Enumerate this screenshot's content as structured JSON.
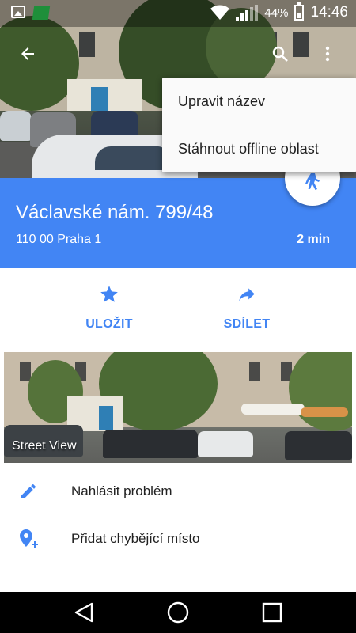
{
  "status_bar": {
    "battery_percent": "44%",
    "time": "14:46",
    "icons": [
      "image-notification-icon",
      "maps-notification-icon",
      "wifi-icon",
      "signal-icon",
      "battery-icon"
    ]
  },
  "app_bar": {
    "icons": [
      "back-arrow-icon",
      "search-icon",
      "more-vert-icon"
    ]
  },
  "overflow_menu": {
    "items": [
      {
        "label": "Upravit název"
      },
      {
        "label": "Stáhnout offline oblast"
      }
    ]
  },
  "place": {
    "name": "Václavské nám. 799/48",
    "address": "110 00 Praha 1",
    "eta": "2 min",
    "mode_icon": "walking-icon"
  },
  "actions": [
    {
      "label": "ULOŽIT",
      "icon": "star-icon"
    },
    {
      "label": "SDÍLET",
      "icon": "share-icon"
    }
  ],
  "street_view": {
    "label": "Street View"
  },
  "list": [
    {
      "label": "Nahlásit problém",
      "icon": "edit-pencil-icon"
    },
    {
      "label": "Přidat chybějící místo",
      "icon": "add-location-icon"
    }
  ],
  "nav_bar": {
    "icons": [
      "back-triangle-icon",
      "home-circle-icon",
      "recents-square-icon"
    ]
  },
  "colors": {
    "accent": "#4285f4",
    "menu_bg": "#fafafa",
    "nav_bg": "#000000"
  }
}
